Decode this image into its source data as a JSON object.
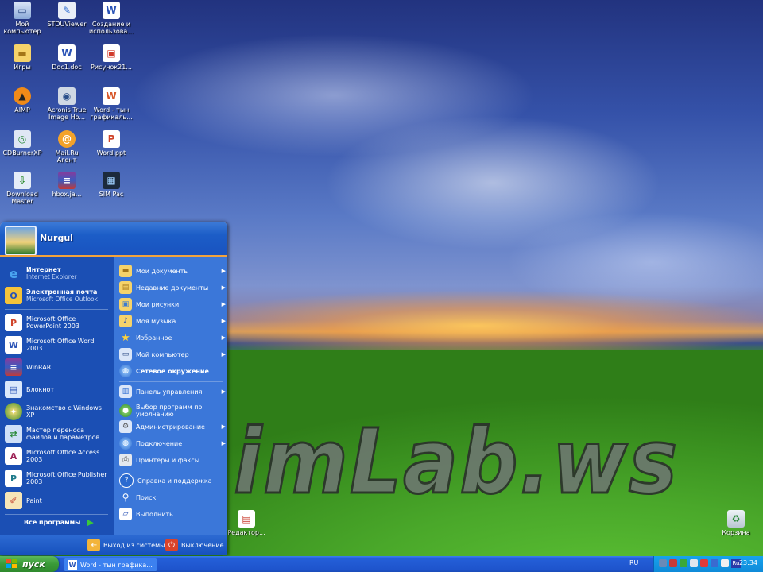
{
  "desktop_icons": [
    {
      "name": "my-computer",
      "label": "Мой компьютер",
      "icon": "computer-icon"
    },
    {
      "name": "stduviewer",
      "label": "STDUViewer",
      "icon": "viewer-icon"
    },
    {
      "name": "sozdanie",
      "label": "Создание и использова...",
      "icon": "word-doc-icon"
    },
    {
      "name": "igry",
      "label": "Игры",
      "icon": "folder-icon"
    },
    {
      "name": "doc1",
      "label": "Doc1.doc",
      "icon": "word-doc-icon"
    },
    {
      "name": "risunok21",
      "label": "Рисунок21...",
      "icon": "picture-icon"
    },
    {
      "name": "aimp",
      "label": "AIMP",
      "icon": "aimp-icon"
    },
    {
      "name": "acronis",
      "label": "Acronis True Image Ho...",
      "icon": "acronis-icon"
    },
    {
      "name": "word-grafika",
      "label": "Word - тын графикаль...",
      "icon": "word-doc-icon"
    },
    {
      "name": "cdburnerxp",
      "label": "CDBurnerXP",
      "icon": "cdburner-icon"
    },
    {
      "name": "mailru",
      "label": "Mail.Ru Агент",
      "icon": "mailru-icon"
    },
    {
      "name": "word-ppt",
      "label": "Word.ppt",
      "icon": "ppt-icon"
    },
    {
      "name": "download-master",
      "label": "Download Master",
      "icon": "download-icon"
    },
    {
      "name": "hbox",
      "label": "hbox.ja...",
      "icon": "winrar-icon"
    },
    {
      "name": "simpac",
      "label": "SIM Pac",
      "icon": "sim-icon"
    },
    {
      "name": "redaktor",
      "label": "Редактор...",
      "icon": "doc-icon"
    },
    {
      "name": "recycle-bin",
      "label": "Корзина",
      "icon": "recycle-bin-icon"
    }
  ],
  "start_menu": {
    "user": "Nurgul",
    "pinned": [
      {
        "title": "Интернет",
        "subtitle": "Internet Explorer",
        "icon": "ie-icon"
      },
      {
        "title": "Электронная почта",
        "subtitle": "Microsoft Office Outlook",
        "icon": "outlook-icon"
      }
    ],
    "recent": [
      {
        "label": "Microsoft Office PowerPoint 2003",
        "icon": "powerpoint-icon"
      },
      {
        "label": "Microsoft Office Word 2003",
        "icon": "word-icon"
      },
      {
        "label": "WinRAR",
        "icon": "winrar-icon"
      },
      {
        "label": "Блокнот",
        "icon": "notepad-icon"
      },
      {
        "label": "Знакомство с Windows XP",
        "icon": "xp-tour-icon"
      },
      {
        "label": "Мастер переноса файлов и параметров",
        "icon": "transfer-wizard-icon"
      },
      {
        "label": "Microsoft Office Access 2003",
        "icon": "access-icon"
      },
      {
        "label": "Microsoft Office Publisher 2003",
        "icon": "publisher-icon"
      },
      {
        "label": "Paint",
        "icon": "paint-icon"
      }
    ],
    "all_programs": "Все программы",
    "right_items": [
      {
        "label": "Мои документы",
        "icon": "my-documents-icon",
        "arrow": "▶"
      },
      {
        "label": "Недавние документы",
        "icon": "recent-docs-icon",
        "arrow": "▶"
      },
      {
        "label": "Мои рисунки",
        "icon": "my-pictures-icon",
        "arrow": "▶"
      },
      {
        "label": "Моя музыка",
        "icon": "my-music-icon",
        "arrow": "▶"
      },
      {
        "label": "Избранное",
        "icon": "favorites-icon",
        "arrow": "▶"
      },
      {
        "label": "Мой компьютер",
        "icon": "my-computer-icon",
        "arrow": "▶"
      },
      {
        "label": "Сетевое окружение",
        "icon": "network-icon",
        "arrow": ""
      },
      {
        "label": "Панель управления",
        "icon": "control-panel-icon",
        "arrow": "▶"
      },
      {
        "label": "Выбор программ по умолчанию",
        "icon": "default-programs-icon",
        "arrow": ""
      },
      {
        "label": "Администрирование",
        "icon": "admin-tools-icon",
        "arrow": "▶"
      },
      {
        "label": "Подключение",
        "icon": "connect-icon",
        "arrow": "▶"
      },
      {
        "label": "Принтеры и факсы",
        "icon": "printers-icon",
        "arrow": ""
      },
      {
        "label": "Справка и поддержка",
        "icon": "help-icon",
        "arrow": ""
      },
      {
        "label": "Поиск",
        "icon": "search-icon",
        "arrow": ""
      },
      {
        "label": "Выполнить...",
        "icon": "run-icon",
        "arrow": ""
      }
    ],
    "logoff": "Выход из системы",
    "shutdown": "Выключение"
  },
  "taskbar": {
    "start_label": "пуск",
    "task_label": "Word - тын графика...",
    "lang": "RU",
    "tray_lang": "Ru",
    "clock": "23:34"
  },
  "wallpaper_text": "imLab.ws",
  "colors": {
    "taskbar": "#245fd8",
    "start_button": "#3a9a38",
    "menu_left": "#1b4fb4",
    "menu_right": "#3b77d9",
    "accent_orange": "#f3a33c"
  }
}
